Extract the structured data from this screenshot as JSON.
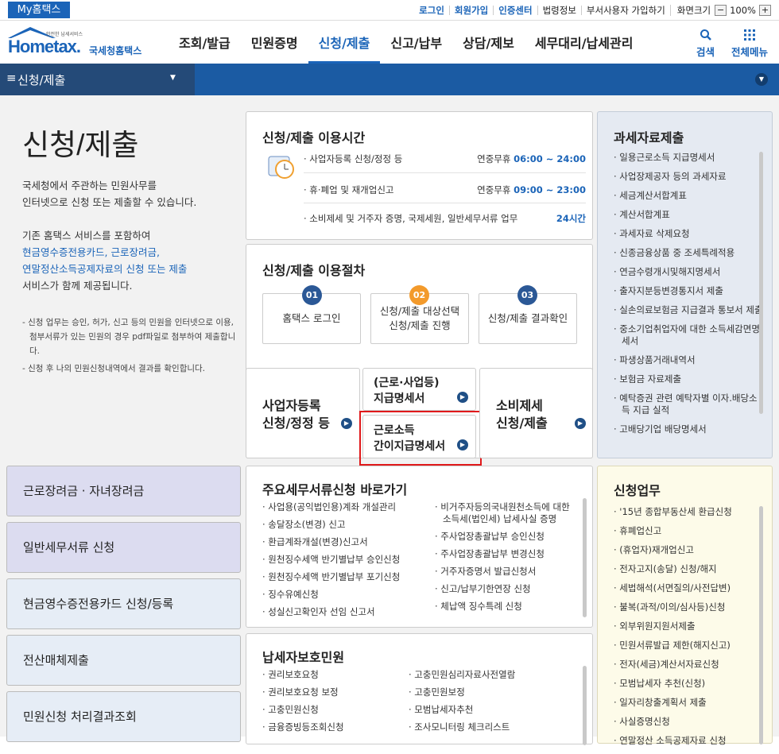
{
  "topbar": {
    "myhome": "My홈택스",
    "login": "로그인",
    "join": "회원가입",
    "cert": "인증센터",
    "law": "법령정보",
    "dept": "부서사용자 가입하기",
    "screen": "화면크기",
    "zoom_minus": "−",
    "zoom": "100%",
    "zoom_plus": "+"
  },
  "logo": {
    "small": "안전한 납세서비스",
    "brand": "Hometax.",
    "sub": "국세청홈택스"
  },
  "menu": [
    "조회/발급",
    "민원증명",
    "신청/제출",
    "신고/납부",
    "상담/제보",
    "세무대리/납세관리"
  ],
  "search_label": "검색",
  "allmenu_label": "전체메뉴",
  "nav": {
    "current": "신청/제출"
  },
  "intro": {
    "title": "신청/제출",
    "p1a": "국세청에서 주관하는 민원사무를",
    "p1b": "인터넷으로 신청 또는 제출할 수 있습니다.",
    "p2a": "기존 홈택스 서비스를 포함하여",
    "p2b": "현금영수증전용카드, 근로장려금,",
    "p2c": "연말정산소득공제자료의 신청 또는 제출",
    "p2d": "서비스가 함께 제공됩니다.",
    "note1": "- 신청 업무는 승인, 허가, 신고 등의 민원을 인터넷으로 이용, 첨부서류가 있는 민원의 경우 pdf파일로 첨부하여 제출합니다.",
    "note2": "- 신청 후 나의 민원신청내역에서 결과를 확인합니다."
  },
  "hours": {
    "title": "신청/제출 이용시간",
    "rows": [
      {
        "label": "· 사업자등록 신청/정정 등",
        "pre": "연중무휴",
        "time": "06:00 ~ 24:00"
      },
      {
        "label": "· 휴·폐업 및 재개업신고",
        "pre": "연중무휴",
        "time": "09:00 ~ 23:00"
      },
      {
        "label": "· 소비제세 및 거주자 증명, 국제세원, 일반세무서류 업무",
        "pre": "",
        "time": "24시간"
      }
    ]
  },
  "procedure": {
    "title": "신청/제출 이용절차",
    "steps": [
      {
        "num": "01",
        "label": "홈택스 로그인",
        "color": "#2b5896"
      },
      {
        "num": "02",
        "label": "신청/제출 대상선택\n신청/제출 진행",
        "color": "#f39a2b"
      },
      {
        "num": "03",
        "label": "신청/제출 결과확인",
        "color": "#2b5896"
      }
    ]
  },
  "quick": {
    "biz": "사업자등록\n신청/정정 등",
    "pay": "(근로·사업등)\n지급명세서",
    "simple": "근로소득\n간이지급명세서",
    "consume": "소비제세\n신청/제출"
  },
  "taxdata": {
    "title": "과세자료제출",
    "items": [
      "일용근로소득 지급명세서",
      "사업장제공자 등의 과세자료",
      "세금계산서합계표",
      "계산서합계표",
      "과세자료 삭제요청",
      "신종금융상품 중 조세특례적용",
      "연금수령개시및해지명세서",
      "출자지분등변경통지서 제출",
      "실손의료보험금 지급결과 통보서 제출",
      "중소기업취업자에 대한 소득세감면명세서",
      "파생상품거래내역서",
      "보험금 자료제출",
      "예탁증권 관련 예탁자별 이자.배당소득 지급 실적",
      "고배당기업 배당명세서"
    ]
  },
  "side": [
    "근로장려금 · 자녀장려금",
    "일반세무서류 신청",
    "현금영수증전용카드 신청/등록",
    "전산매체제출",
    "민원신청 처리결과조회"
  ],
  "major": {
    "title": "주요세무서류신청 바로가기",
    "left": [
      "사업용(공익법인용)계좌 개설관리",
      "송달장소(변경) 신고",
      "환급계좌개설(변경)신고서",
      "원천징수세액 반기별납부 승인신청",
      "원천징수세액 반기별납부 포기신청",
      "징수유예신청",
      "성실신고확인자 선임 신고서"
    ],
    "right": [
      "비거주자등의국내원천소득에 대한 소득세(법인세) 납세사실 증명",
      "주사업장총괄납부 승인신청",
      "주사업장총괄납부 변경신청",
      "거주자증명서 발급신청서",
      "신고/납부기한연장 신청",
      "체납액 징수특례 신청"
    ]
  },
  "protect": {
    "title": "납세자보호민원",
    "left": [
      "권리보호요청",
      "권리보호요청 보정",
      "고충민원신청",
      "금융증빙등조회신청"
    ],
    "right": [
      "고충민원심리자료사전열람",
      "고충민원보정",
      "모범납세자추천",
      "조사모니터링 체크리스트"
    ]
  },
  "apply": {
    "title": "신청업무",
    "items": [
      "'15년 종합부동산세 환급신청",
      "휴폐업신고",
      "(휴업자)재개업신고",
      "전자고지(송달) 신청/해지",
      "세법해석(서면질의/사전답변)",
      "불복(과적/이의/심사등)신청",
      "외부위원지원서제출",
      "민원서류발급 제한(해지신고)",
      "전자(세금)계산서자료신청",
      "모범납세자 추천(신청)",
      "일자리창출계획서 제출",
      "사실증명신청",
      "연말정산 소득공제자료 신청"
    ]
  }
}
